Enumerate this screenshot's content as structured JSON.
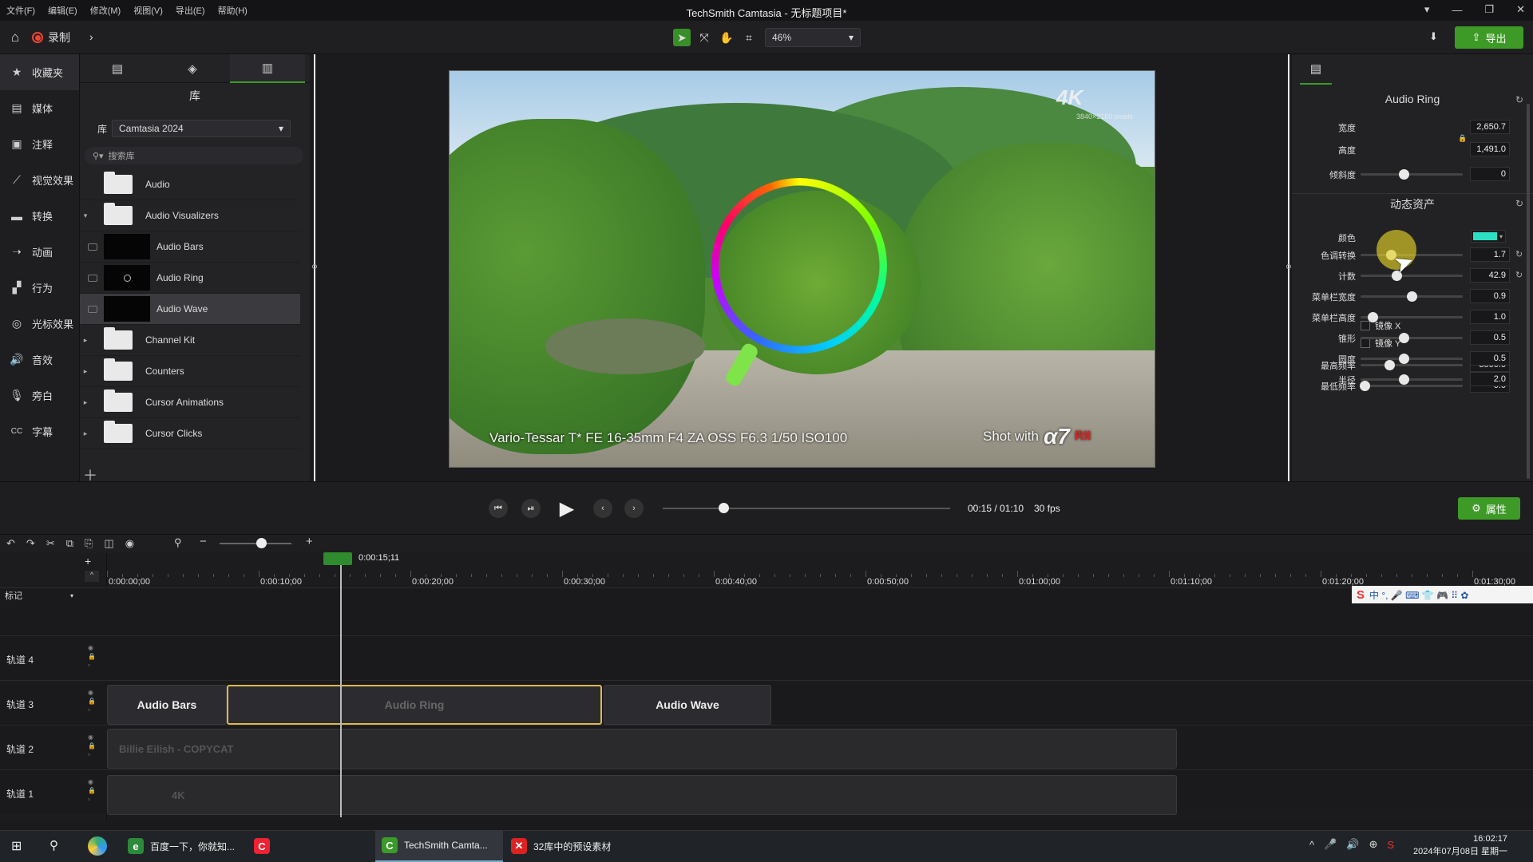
{
  "window": {
    "title": "TechSmith Camtasia - 无标题项目*"
  },
  "menu": [
    "文件(F)",
    "编辑(E)",
    "修改(M)",
    "视图(V)",
    "导出(E)",
    "帮助(H)"
  ],
  "toolbar": {
    "record_label": "录制",
    "zoom_value": "46%",
    "export_label": "导出"
  },
  "nav": [
    {
      "label": "收藏夹",
      "icon": "star-icon"
    },
    {
      "label": "媒体",
      "icon": "media-icon"
    },
    {
      "label": "注释",
      "icon": "annotation-icon"
    },
    {
      "label": "视觉效果",
      "icon": "wand-icon"
    },
    {
      "label": "转换",
      "icon": "transition-icon"
    },
    {
      "label": "动画",
      "icon": "animation-icon"
    },
    {
      "label": "行为",
      "icon": "behavior-icon"
    },
    {
      "label": "光标效果",
      "icon": "cursor-icon"
    },
    {
      "label": "音效",
      "icon": "speaker-icon"
    },
    {
      "label": "旁白",
      "icon": "microphone-icon"
    },
    {
      "label": "字幕",
      "icon": "captions-icon"
    }
  ],
  "library": {
    "header": "库",
    "lib_label": "库",
    "selected_library": "Camtasia 2024",
    "search_placeholder": "搜索库",
    "items": [
      {
        "label": "Audio",
        "type": "folder",
        "caret": ""
      },
      {
        "label": "Audio Visualizers",
        "type": "folder",
        "caret": "▾"
      },
      {
        "label": "Audio Bars",
        "type": "asset"
      },
      {
        "label": "Audio Ring",
        "type": "asset"
      },
      {
        "label": "Audio Wave",
        "type": "asset",
        "selected": true
      },
      {
        "label": "Channel Kit",
        "type": "folder",
        "caret": "▸"
      },
      {
        "label": "Counters",
        "type": "folder",
        "caret": "▸"
      },
      {
        "label": "Cursor Animations",
        "type": "folder",
        "caret": "▸"
      },
      {
        "label": "Cursor Clicks",
        "type": "folder",
        "caret": "▸"
      }
    ]
  },
  "video": {
    "logo": "4K",
    "logo_sub": "3840×2160 pixels",
    "caption": "Vario-Tessar T* FE 16-35mm  F4 ZA OSS   F6.3  1/50  ISO100",
    "shot_with": "Shot with",
    "camera_model": "α7",
    "camera_suffix": "RII"
  },
  "properties": {
    "title": "Audio Ring",
    "width_label": "宽度",
    "width_value": "2,650.7",
    "height_label": "高度",
    "height_value": "1,491.0",
    "tilt_label": "倾斜度",
    "tilt_value": "0",
    "tilt_level": 0.42,
    "section2": "动态资产",
    "color_label": "颜色",
    "color_value": "#2ce0c4",
    "sliders": [
      {
        "label": "色调转换",
        "value": "1.7",
        "level": 0.3,
        "reset": true
      },
      {
        "label": "计数",
        "value": "42.9",
        "level": 0.35,
        "reset": true
      },
      {
        "label": "菜单栏宽度",
        "value": "0.9",
        "level": 0.5
      },
      {
        "label": "菜单栏高度",
        "value": "1.0",
        "level": 0.12
      },
      {
        "label": "锥形",
        "value": "0.5",
        "level": 0.42
      },
      {
        "label": "圆度",
        "value": "0.5",
        "level": 0.42
      },
      {
        "label": "半径",
        "value": "2.0",
        "level": 0.42
      }
    ],
    "mirror_x": "镜像 X",
    "mirror_y": "镜像 Y",
    "max_freq_label": "最高频率",
    "max_freq_value": "3500.0",
    "max_freq_level": 0.28,
    "min_freq_label": "最低频率",
    "min_freq_value": "0.0",
    "min_freq_level": 0.04
  },
  "transport": {
    "timecode": "00:15 / 01:10",
    "fps": "30 fps",
    "progress": 0.21,
    "properties_label": "属性"
  },
  "timeline": {
    "playhead_time": "0:00:15;11",
    "ruler": [
      "0:00:00;00",
      "0:00:10;00",
      "0:00:20;00",
      "0:00:30;00",
      "0:00:40;00",
      "0:00:50;00",
      "0:01:00;00",
      "0:01:10;00",
      "0:01:20;00",
      "0:01:30;00"
    ],
    "marker_label": "标记",
    "tracks": [
      "轨道 4",
      "轨道 3",
      "轨道 2",
      "轨道 1"
    ],
    "clips": {
      "audio_bars": "Audio Bars",
      "audio_ring": "Audio Ring",
      "audio_wave": "Audio Wave",
      "music": "Billie Eilish - COPYCAT",
      "video": "4K"
    }
  },
  "ime": {
    "brand": "S",
    "text": "中 °, 🎤 ⌨ 👕 🎮 ⠿ ✿"
  },
  "taskbar": {
    "apps": [
      "百度一下，你就知...",
      "",
      "TechSmith Camta...",
      "32库中的预设素材"
    ],
    "time": "16:02:17",
    "date": "2024年07月08日 星期一"
  }
}
